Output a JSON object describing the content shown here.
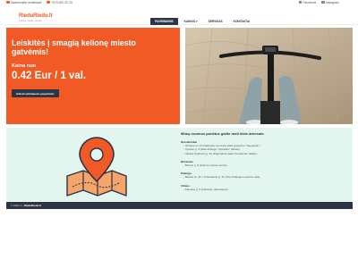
{
  "topbar": {
    "email": "Skambinkite nedelsiant",
    "phone": "+370 620 22 33",
    "facebook": "Facebook",
    "instagram": "Instagram"
  },
  "brand": {
    "name": "RieduRiedu.lt",
    "tagline": "Lankyk, riedek, atrask"
  },
  "nav": {
    "items": [
      "PAGRINDINIS",
      "KAINOS",
      "SERVISAS",
      "KONTAKTAI"
    ],
    "active_index": 0,
    "dropdown_caret": "▾"
  },
  "hero": {
    "headline": "Leiskitės į smagią kelionę miesto gatvėmis!",
    "price_label": "Kaina nuo",
    "price": "0.42 Eur / 1 val.",
    "cta": "Ieškoti artimiausio paspirtuko"
  },
  "locations": {
    "title": "Mūsų nuomos punktus galite rasti šiais adresais:",
    "groups": [
      {
        "city": "Druskininkai",
        "addresses": [
          "- Vilniaus al. 14 (Galimybė nuomotis šalia restorano \"Nepupark\")",
          "- Vytauto g. 3 (šalia džiaugs \"Vijūnėlės\" parkas)",
          "- Vasarė Ciurlionio g. 60 (Pagrindinis šalia \"Druskeriai\" aikštė)"
        ]
      },
      {
        "city": "Birštonas",
        "addresses": [
          "- Birutės g. 8 (Kurorto miesto centre)"
        ]
      },
      {
        "city": "Palanga",
        "addresses": [
          "- Birutės al. 34 ir S.Daukanto g. 34 (Ties Palangos centrine sale)"
        ]
      },
      {
        "city": "Vilnius",
        "addresses": [
          "- Kamanų g. 5 (Kalvarijų mikrorajone)"
        ]
      }
    ]
  },
  "footer": {
    "text": "© 2022 m. ",
    "brand": "RieduRiedu.lt"
  },
  "colors": {
    "accent": "#f15a24",
    "dark": "#2c3446",
    "mint": "#e3f5ef"
  }
}
